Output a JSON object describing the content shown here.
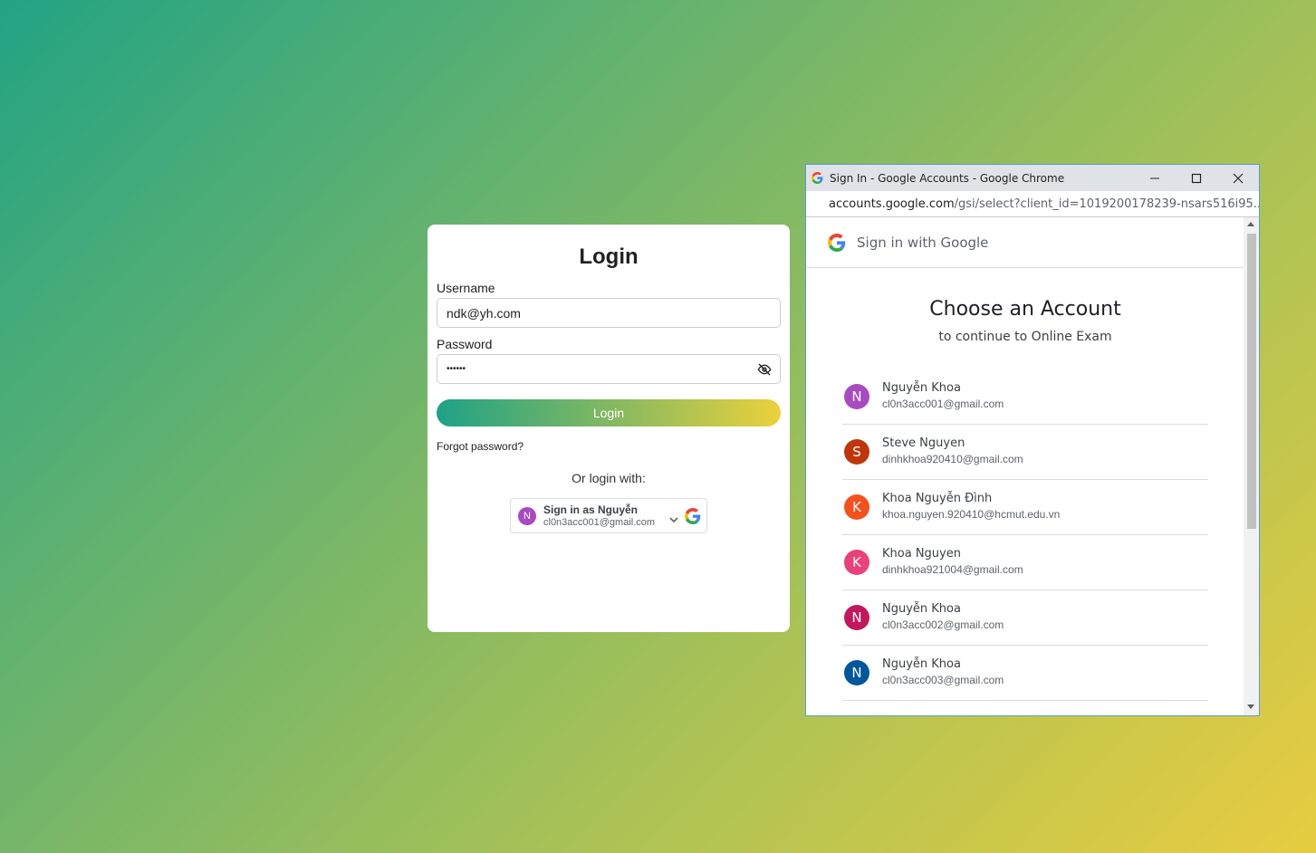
{
  "login": {
    "title": "Login",
    "username_label": "Username",
    "username_value": "ndk@yh.com",
    "password_label": "Password",
    "password_value": "••••••",
    "login_button": "Login",
    "forgot_password": "Forgot password?",
    "or_login_with": "Or login with:",
    "google_button": {
      "avatar_letter": "N",
      "name": "Sign in as Nguyễn",
      "email": "cl0n3acc001@gmail.com",
      "avatar_color": "#a84bc0"
    }
  },
  "popup": {
    "window_title": "Sign In - Google Accounts - Google Chrome",
    "url_host": "accounts.google.com",
    "url_path": "/gsi/select?client_id=1019200178239-nsars516i95...",
    "header": "Sign in with Google",
    "heading": "Choose an Account",
    "subheading": "to continue to Online Exam",
    "accounts": [
      {
        "letter": "N",
        "name": "Nguyễn Khoa",
        "email": "cl0n3acc001@gmail.com",
        "color": "#a84bc0"
      },
      {
        "letter": "S",
        "name": "Steve Nguyen",
        "email": "dinhkhoa920410@gmail.com",
        "color": "#bf360c"
      },
      {
        "letter": "K",
        "name": "Khoa Nguyễn Đình",
        "email": "khoa.nguyen.920410@hcmut.edu.vn",
        "color": "#f4511e"
      },
      {
        "letter": "K",
        "name": "Khoa Nguyen",
        "email": "dinhkhoa921004@gmail.com",
        "color": "#ec407a"
      },
      {
        "letter": "N",
        "name": "Nguyễn Khoa",
        "email": "cl0n3acc002@gmail.com",
        "color": "#c2185b"
      },
      {
        "letter": "N",
        "name": "Nguyễn Khoa",
        "email": "cl0n3acc003@gmail.com",
        "color": "#01579b"
      }
    ]
  }
}
